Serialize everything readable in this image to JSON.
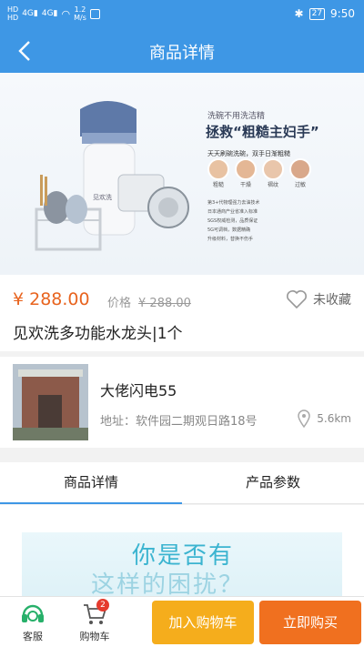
{
  "status_bar": {
    "net_label_1": "HD",
    "net_label_2": "HD",
    "signal_1": "4G",
    "signal_2": "4G",
    "speed_value": "1.2",
    "speed_unit": "M/s",
    "battery": "27",
    "time": "9:50"
  },
  "header": {
    "title": "商品详情"
  },
  "product": {
    "price": "¥ 288.00",
    "original_price_label": "价格",
    "original_price": "¥ 288.00",
    "favorite_label": "未收藏",
    "name": "见欢洗多功能水龙头|1个"
  },
  "banner": {
    "headline_1": "洗碗不用洗洁精",
    "headline_2": "拯救“粗糙主妇手”",
    "subline": "天天刷碗洗碗，双手日渐粗糙",
    "hand_labels": [
      "粗糙",
      "干燥",
      "褶纹",
      "过敏"
    ],
    "bullets": [
      "第3+代物理强力去油技术",
      "日本通商产业省准入标准",
      "SGS权威检测，品质保证",
      "5G可调档，数据精确",
      "升级材料，替换不伤手"
    ],
    "brand": "见欢洗"
  },
  "store": {
    "name": "大佬闪电55",
    "address": "地址：软件园二期观日路18号",
    "distance": "5.6km"
  },
  "tabs": [
    {
      "label": "商品详情",
      "active": true
    },
    {
      "label": "产品参数",
      "active": false
    }
  ],
  "detail": {
    "text_line_1": "你是否有",
    "text_line_2": "这样的困扰？"
  },
  "bottom_bar": {
    "service_label": "客服",
    "cart_label": "购物车",
    "cart_count": "2",
    "add_to_cart": "加入购物车",
    "buy_now": "立即购买"
  },
  "colors": {
    "primary": "#3e97e5",
    "price": "#e8641f",
    "cart_button": "#f5ad1c",
    "buy_button": "#f0701f"
  }
}
